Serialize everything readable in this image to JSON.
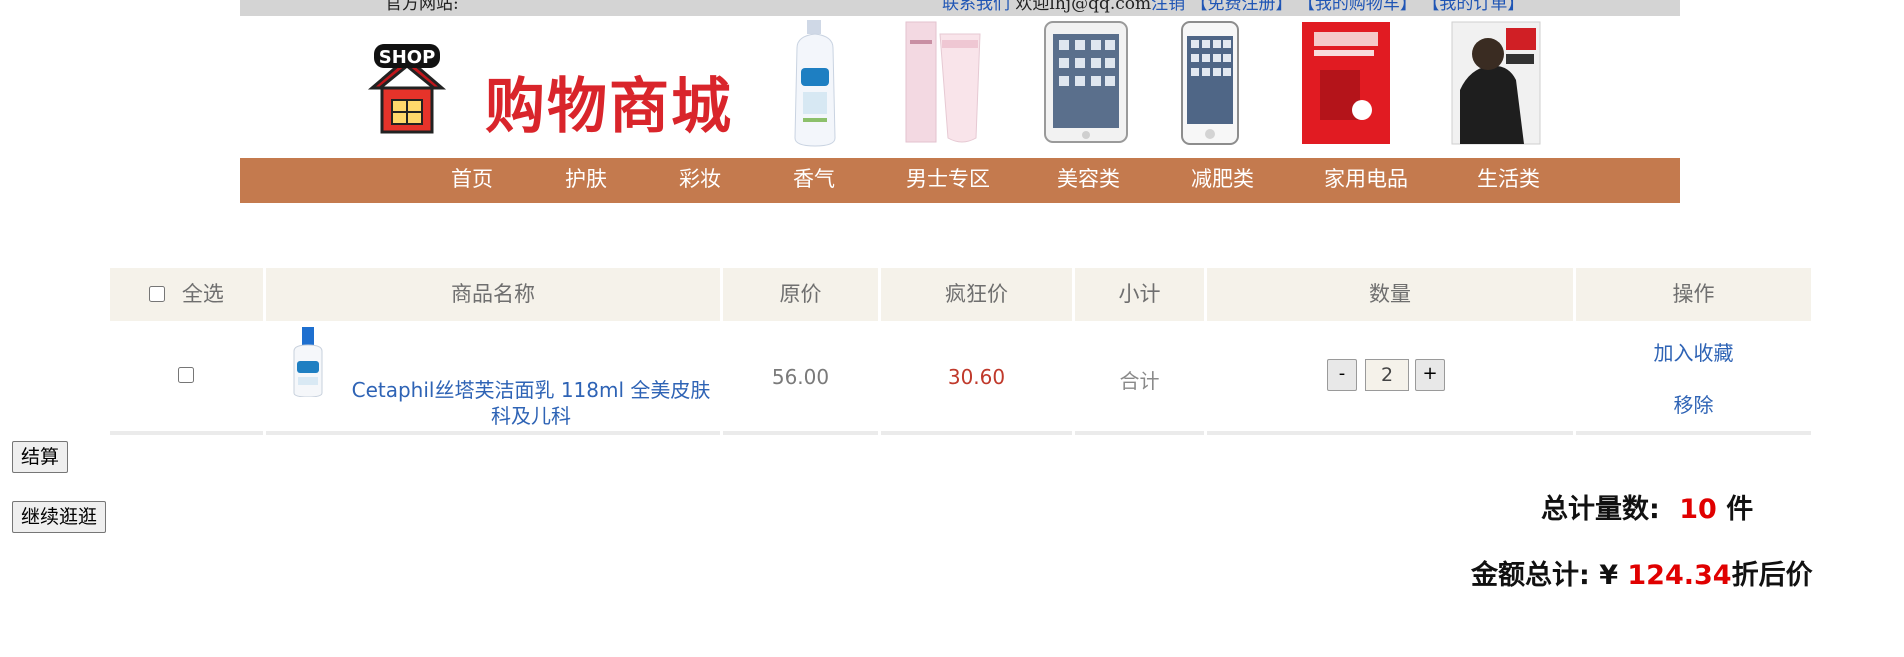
{
  "topbar": {
    "site_label": "官方网站:",
    "contact_link": "联系我们",
    "welcome_text": "欢迎lhj@qq.com",
    "logout_link": "注销",
    "register_link": "【免费注册】",
    "cart_link": "【我的购物车】",
    "orders_link": "【我的订单】"
  },
  "header": {
    "logo_badge": "SHOP",
    "logo_text": "购物商城"
  },
  "nav": {
    "items": [
      "首页",
      "护肤",
      "彩妆",
      "香气",
      "男士专区",
      "美容类",
      "减肥类",
      "家用电品",
      "生活类"
    ]
  },
  "cart": {
    "headers": {
      "select_all": "全选",
      "name": "商品名称",
      "original_price": "原价",
      "sale_price": "疯狂价",
      "subtotal": "小计",
      "quantity": "数量",
      "actions": "操作"
    },
    "rows": [
      {
        "name": "Cetaphil丝塔芙洁面乳 118ml 全美皮肤科及儿科",
        "original_price": "56.00",
        "sale_price": "30.60",
        "subtotal": "合计",
        "quantity": "2",
        "minus": "-",
        "plus": "+",
        "favorite": "加入收藏",
        "remove": "移除"
      }
    ]
  },
  "buttons": {
    "checkout": "结算",
    "continue_shopping": "继续逛逛"
  },
  "summary": {
    "total_count_label": "总计量数:",
    "total_count_value": "10",
    "total_count_unit": "件",
    "total_amount_label": "金额总计: ¥",
    "total_amount_value": "124.34",
    "total_amount_suffix": "折后价"
  },
  "colors": {
    "nav_bg": "#c47a4e",
    "header_bg": "#f5f2ea",
    "price_red": "#c0392b",
    "link_blue": "#2e63b5",
    "accent_red": "#e00000"
  }
}
